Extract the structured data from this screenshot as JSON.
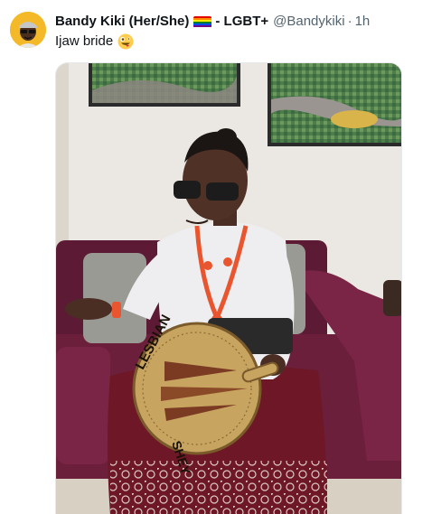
{
  "tweet": {
    "display_name": "Bandy Kiki (Her/She)",
    "badge_text": "- LGBT+",
    "handle": "@Bandykiki",
    "separator": "·",
    "time": "1h",
    "text": "Ijaw bride",
    "emoji": "zany-face-emoji",
    "flag": "rainbow-flag-icon"
  },
  "media": {
    "fan_text_top": "LESBIAN",
    "fan_text_bottom": "SHEY"
  },
  "colors": {
    "avatar_bg": "#f3b928",
    "sofa": "#6b1f3b",
    "wall": "#eae6e0",
    "muted_text": "#536471"
  }
}
